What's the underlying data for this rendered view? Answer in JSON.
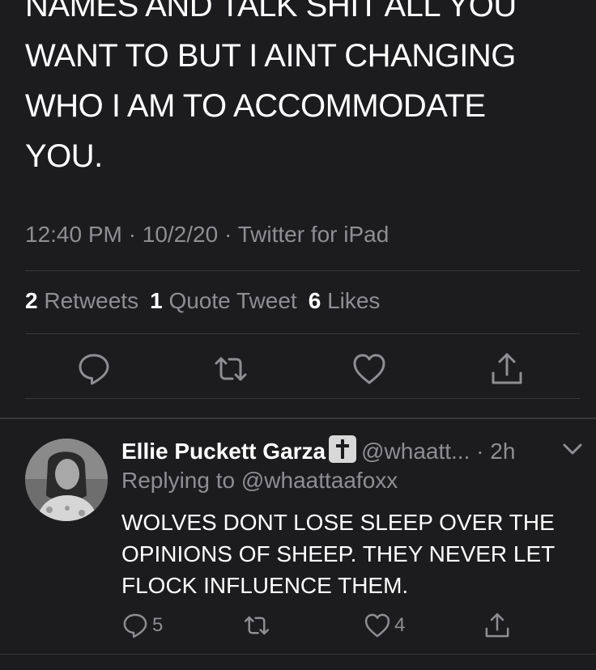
{
  "tweet": {
    "text_lines": [
      "NAMES AND TALK SHIT ALL YOU",
      "WANT TO BUT I AINT CHANGING",
      "WHO I AM TO ACCOMMODATE",
      "YOU."
    ],
    "time": "12:40 PM",
    "date": "10/2/20",
    "source": "Twitter for iPad",
    "separator": "·",
    "stats": {
      "retweets_count": "2",
      "retweets_label": "Retweets",
      "quotes_count": "1",
      "quotes_label": "Quote Tweet",
      "likes_count": "6",
      "likes_label": "Likes"
    },
    "actions": [
      "reply-icon",
      "retweet-icon",
      "like-icon",
      "share-icon"
    ]
  },
  "reply": {
    "name": "Ellie Puckett Garza",
    "badge_icon": "cross-icon",
    "handle": "@whaatt...",
    "time_ago": "· 2h",
    "replying_to": "Replying to @whaattaafoxx",
    "text_lines": [
      "WOLVES DONT LOSE SLEEP OVER THE",
      "OPINIONS OF SHEEP. THEY NEVER LET",
      "FLOCK INFLUENCE THEM."
    ],
    "reply_count": "5",
    "retweet_count": "",
    "like_count": "4"
  },
  "colors": {
    "background": "#1c1c1e",
    "text": "#ffffff",
    "secondary": "#8e8e93",
    "divider": "#38383a"
  }
}
